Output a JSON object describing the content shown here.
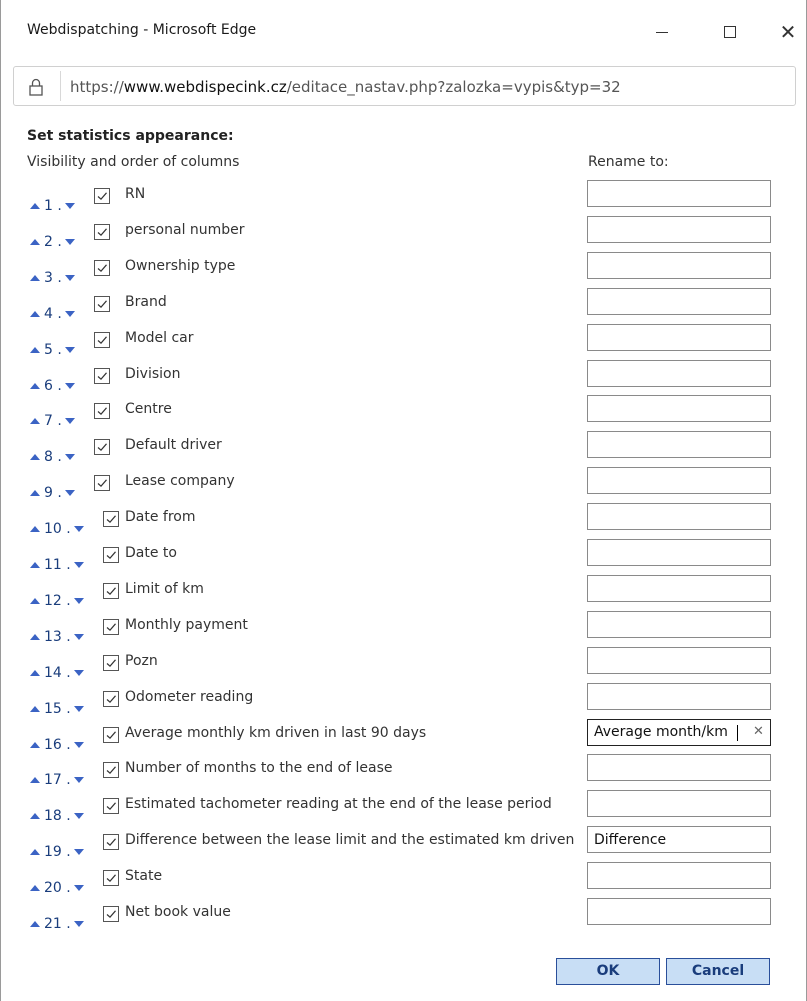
{
  "window": {
    "title": "Webdispatching - Microsoft Edge",
    "url_prefix": "https://",
    "url_host": "www.webdispecink.cz",
    "url_path": "/editace_nastav.php?zalozka=vypis&typ=32"
  },
  "page": {
    "heading": "Set statistics appearance:",
    "columns_label": "Visibility and order of columns",
    "rename_label": "Rename to:"
  },
  "rows": [
    {
      "num": "1 .",
      "label": "RN",
      "checked": true,
      "rename": ""
    },
    {
      "num": "2 .",
      "label": "personal number",
      "checked": true,
      "rename": ""
    },
    {
      "num": "3 .",
      "label": "Ownership type",
      "checked": true,
      "rename": ""
    },
    {
      "num": "4 .",
      "label": "Brand",
      "checked": true,
      "rename": ""
    },
    {
      "num": "5 .",
      "label": "Model car",
      "checked": true,
      "rename": ""
    },
    {
      "num": "6 .",
      "label": "Division",
      "checked": true,
      "rename": ""
    },
    {
      "num": "7 .",
      "label": "Centre",
      "checked": true,
      "rename": ""
    },
    {
      "num": "8 .",
      "label": "Default driver",
      "checked": true,
      "rename": ""
    },
    {
      "num": "9 .",
      "label": "Lease company",
      "checked": true,
      "rename": ""
    },
    {
      "num": "10 .",
      "label": "Date from",
      "checked": true,
      "rename": ""
    },
    {
      "num": "11 .",
      "label": "Date to",
      "checked": true,
      "rename": ""
    },
    {
      "num": "12 .",
      "label": "Limit of km",
      "checked": true,
      "rename": ""
    },
    {
      "num": "13 .",
      "label": "Monthly payment",
      "checked": true,
      "rename": ""
    },
    {
      "num": "14 .",
      "label": "Pozn",
      "checked": true,
      "rename": ""
    },
    {
      "num": "15 .",
      "label": "Odometer reading",
      "checked": true,
      "rename": ""
    },
    {
      "num": "16 .",
      "label": "Average monthly km driven in last 90 days",
      "checked": true,
      "rename": "Average month/km"
    },
    {
      "num": "17 .",
      "label": "Number of months to the end of lease",
      "checked": true,
      "rename": ""
    },
    {
      "num": "18 .",
      "label": "Estimated tachometer reading at the end of the lease period",
      "checked": true,
      "rename": ""
    },
    {
      "num": "19 .",
      "label": "Difference between the lease limit and the estimated km driven",
      "checked": true,
      "rename": "Difference"
    },
    {
      "num": "20 .",
      "label": "State",
      "checked": true,
      "rename": ""
    },
    {
      "num": "21 .",
      "label": "Net book value",
      "checked": true,
      "rename": ""
    }
  ],
  "buttons": {
    "ok": "OK",
    "cancel": "Cancel"
  },
  "colors": {
    "accent": "#3b63c4",
    "button_bg": "#c8def5",
    "button_border": "#2a4f9a"
  }
}
